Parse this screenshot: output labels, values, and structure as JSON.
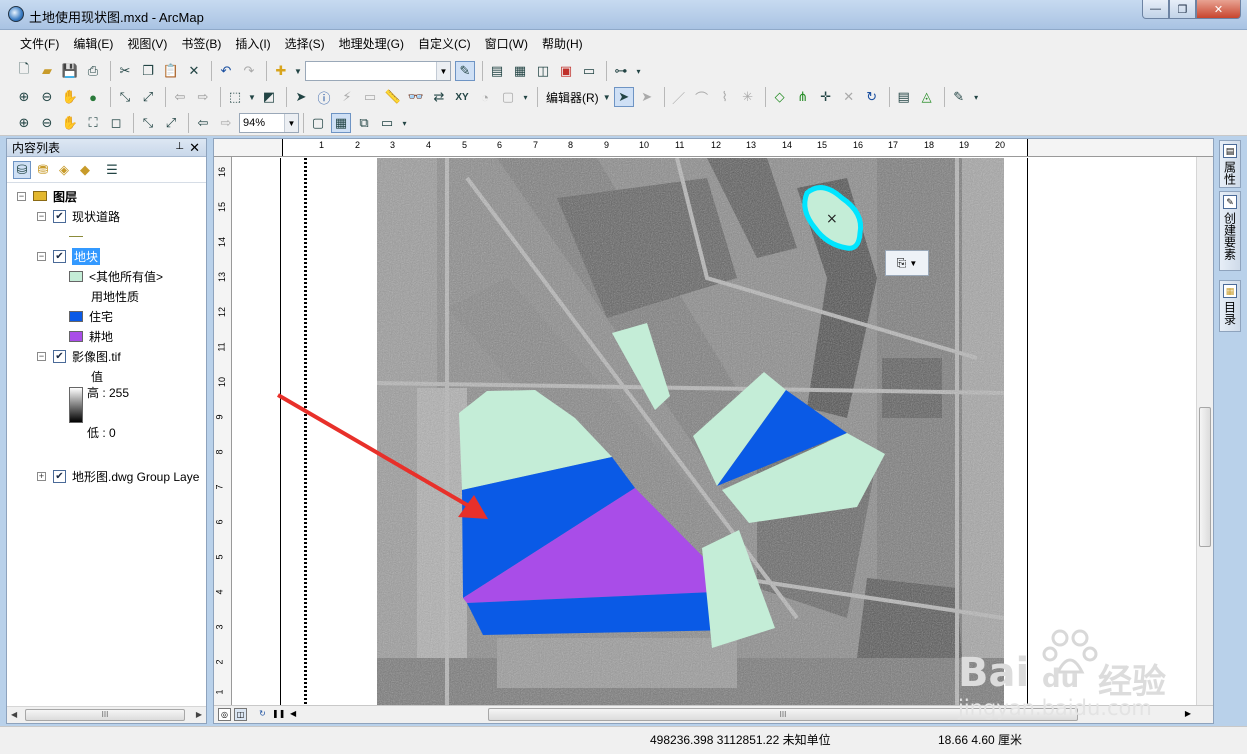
{
  "window": {
    "title": "土地使用现状图.mxd - ArcMap",
    "minimize": "—",
    "restore": "❐",
    "close": "✕"
  },
  "menu": [
    "文件(F)",
    "编辑(E)",
    "视图(V)",
    "书签(B)",
    "插入(I)",
    "选择(S)",
    "地理处理(G)",
    "自定义(C)",
    "窗口(W)",
    "帮助(H)"
  ],
  "toolbar": {
    "editor_label": "编辑器(R)",
    "zoom_value": "94%"
  },
  "toc": {
    "title": "内容列表",
    "pin": "⊥",
    "close": "✕",
    "layers_root": "图层",
    "layers": [
      {
        "name": "现状道路",
        "checked": true
      },
      {
        "name": "地块",
        "checked": true,
        "selected": true,
        "legend": {
          "other": "<其他所有值>",
          "field": "用地性质",
          "classes": [
            {
              "label": "住宅",
              "color": "#0a5ae6"
            },
            {
              "label": "耕地",
              "color": "#a94de8"
            }
          ],
          "other_color": "#c4edd7"
        }
      },
      {
        "name": "影像图.tif",
        "checked": true,
        "legend": {
          "field": "值",
          "high": "高 : 255",
          "low": "低 : 0"
        }
      },
      {
        "name": "地形图.dwg Group Laye",
        "checked": true,
        "collapsed": true
      }
    ],
    "hscroll_grip": "III"
  },
  "ruler": {
    "top_ticks": [
      "1",
      "2",
      "3",
      "4",
      "5",
      "6",
      "7",
      "8",
      "9",
      "10",
      "11",
      "12",
      "13",
      "14",
      "15",
      "16",
      "17",
      "18",
      "19",
      "20"
    ],
    "left_ticks": [
      "16",
      "15",
      "14",
      "13",
      "12",
      "11",
      "10",
      "9",
      "8",
      "7",
      "6",
      "5",
      "4",
      "3",
      "2",
      "1"
    ]
  },
  "layout": {
    "hscroll_grip": "III"
  },
  "right_dock": [
    {
      "label": "属性",
      "icon": "properties-icon"
    },
    {
      "label": "创建要素",
      "icon": "create-features-icon"
    },
    {
      "label": "目录",
      "icon": "catalog-icon"
    }
  ],
  "status": {
    "coords": "498236.398  3112851.22 未知单位",
    "page_pos": "18.66  4.60 厘米"
  },
  "watermark": {
    "brand": "Bai",
    "brand_cn": "经验",
    "url": "jingyan.baidu.com"
  },
  "colors": {
    "residential": "#0a5ae6",
    "farmland": "#a94de8",
    "other": "#c4edd7",
    "selection": "#00e5ff",
    "arrow": "#e8302a"
  }
}
